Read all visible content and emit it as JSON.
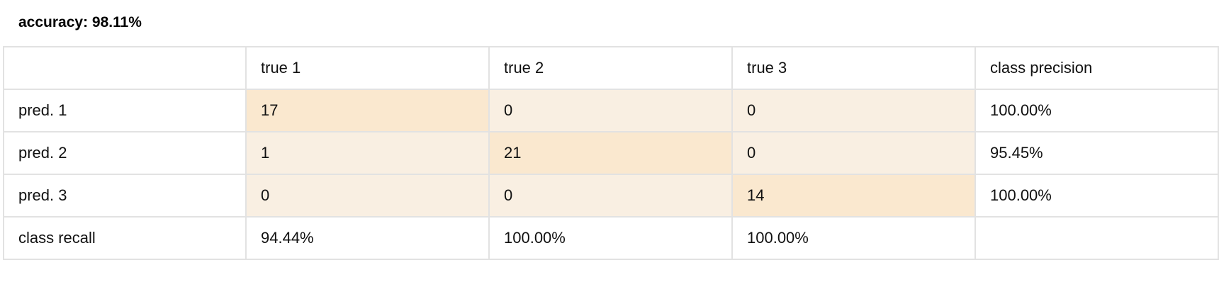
{
  "header": {
    "accuracy_label": "accuracy: 98.11%"
  },
  "colors": {
    "diagonal_cell": "#fae8cf",
    "off_diagonal_cell": "#f9efe2",
    "grid": "#e2e2e2"
  },
  "chart_data": {
    "type": "table",
    "title": "accuracy: 98.11%",
    "columns": [
      "",
      "true 1",
      "true 2",
      "true 3",
      "class precision"
    ],
    "rows": [
      [
        "pred. 1",
        "17",
        "0",
        "0",
        "100.00%"
      ],
      [
        "pred. 2",
        "1",
        "21",
        "0",
        "95.45%"
      ],
      [
        "pred. 3",
        "0",
        "0",
        "14",
        "100.00%"
      ],
      [
        "class recall",
        "94.44%",
        "100.00%",
        "100.00%",
        ""
      ]
    ],
    "matrix": [
      [
        17,
        0,
        0
      ],
      [
        1,
        21,
        0
      ],
      [
        0,
        0,
        14
      ]
    ]
  }
}
